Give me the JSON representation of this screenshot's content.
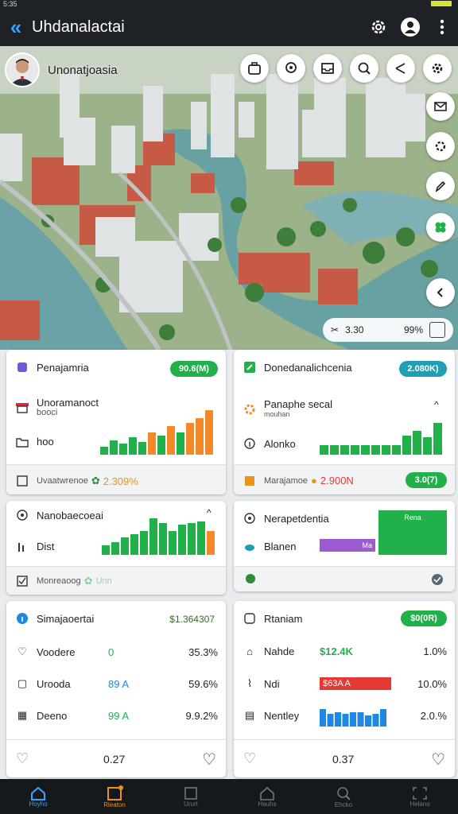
{
  "status": {
    "time": "5:35"
  },
  "header": {
    "title": "Uhdanalactai",
    "back_icon": "chevron-double-left-icon",
    "actions": [
      "gear-icon",
      "person-icon",
      "more-vert-icon"
    ]
  },
  "hero": {
    "profile_name": "Unonatjoasia",
    "top_icons": [
      "briefcase-icon",
      "location-pin-icon",
      "inbox-icon",
      "search-icon",
      "share-icon",
      "settings-icon"
    ],
    "side_icons": [
      "mail-icon",
      "gear-icon",
      "edit-icon",
      "clover-icon",
      "chevron-left-icon"
    ],
    "pill": {
      "value1": "3.30",
      "value2": "99%"
    }
  },
  "cards": {
    "c1": {
      "title": "Penajamria",
      "badge": "90.6(M)",
      "row1": "Unoramanoct",
      "row1_sub": "booci",
      "row2": "hoo",
      "footer": "Uvaatwrenoe",
      "footer_value": "2.309%"
    },
    "c2": {
      "title": "Donedanalichcenia",
      "badge": "2.080K)",
      "row1": "Panaphe secal",
      "row1_sub": "mouhan",
      "row2": "Alonko",
      "footer": "Marajamoe",
      "footer_value": "2.900N",
      "footer_badge": "3.0(7)"
    },
    "c3": {
      "title": "Nanobaecoeai",
      "row2": "Dist",
      "footer": "Monreaoog",
      "footer_value": "Unn"
    },
    "c4": {
      "title": "Nerapetdentia",
      "row2": "Blanen",
      "box_label": "Rena",
      "bar_label": "Ma"
    },
    "c5": {
      "title": "Simajaoertai",
      "head_value": "$1.364307",
      "rows": [
        {
          "label": "Voodere",
          "v1": "0",
          "v2": "35.3%"
        },
        {
          "label": "Urooda",
          "v1": "89 A",
          "v2": "59.6%"
        },
        {
          "label": "Deeno",
          "v1": "99 A",
          "v2": "9.9.2%"
        }
      ],
      "footer_value": "0.27"
    },
    "c6": {
      "title": "Rtaniam",
      "badge": "$0(0R)",
      "rows": [
        {
          "label": "Nahde",
          "v1": "$12.4K",
          "v2": "1.0%"
        },
        {
          "label": "Ndi",
          "v1": "$63A A",
          "v2": "10.0%"
        },
        {
          "label": "Nentley",
          "v1": "",
          "v2": "2.0.%"
        }
      ],
      "footer_value": "0.37"
    }
  },
  "nav": {
    "items": [
      "Hoyho",
      "Rleaton",
      "Ururt",
      "Hauhs",
      "Ehcko",
      "Helano"
    ]
  },
  "colors": {
    "green": "#22b04b",
    "orange": "#f4892a",
    "teal": "#1e9fb5",
    "red": "#e53935",
    "blue": "#1e88e5",
    "purple": "#9c5bd1"
  }
}
